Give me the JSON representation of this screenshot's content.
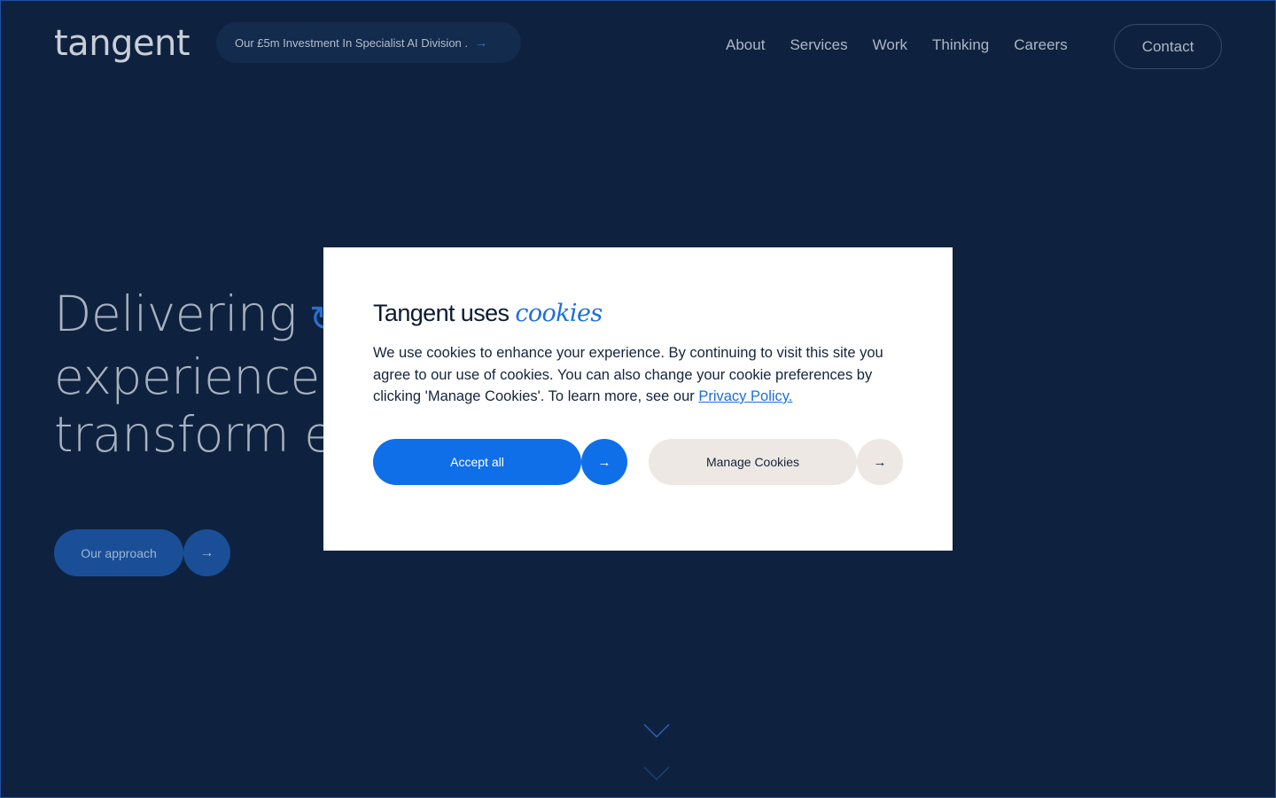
{
  "header": {
    "logo": "tangent",
    "announcement": "Our £5m Investment In Specialist AI Division .",
    "announcement_arrow": "→",
    "nav": [
      "About",
      "Services",
      "Work",
      "Thinking",
      "Careers"
    ],
    "contact_label": "Contact"
  },
  "hero": {
    "line1": "Delivering",
    "line1_icon": "↻↗",
    "line2": "experiences",
    "line3": "transform en",
    "cta_label": "Our approach",
    "cta_arrow": "→"
  },
  "cookie_modal": {
    "title_plain": "Tangent uses ",
    "title_emphasis": "cookies",
    "body": "We use cookies to enhance your experience. By continuing to visit this site you agree to our use of cookies. You can also change your cookie preferences by clicking 'Manage Cookies'. To learn more, see our ",
    "privacy_link": "Privacy Policy.",
    "accept_label": "Accept all",
    "manage_label": "Manage Cookies",
    "arrow": "→"
  },
  "colors": {
    "background": "#0e2240",
    "accent": "#0f6fe8",
    "manage_bg": "#ede8e3"
  },
  "icons": [
    "arrow-right-icon",
    "swirl-arrow-icon",
    "chevron-down-icon"
  ]
}
